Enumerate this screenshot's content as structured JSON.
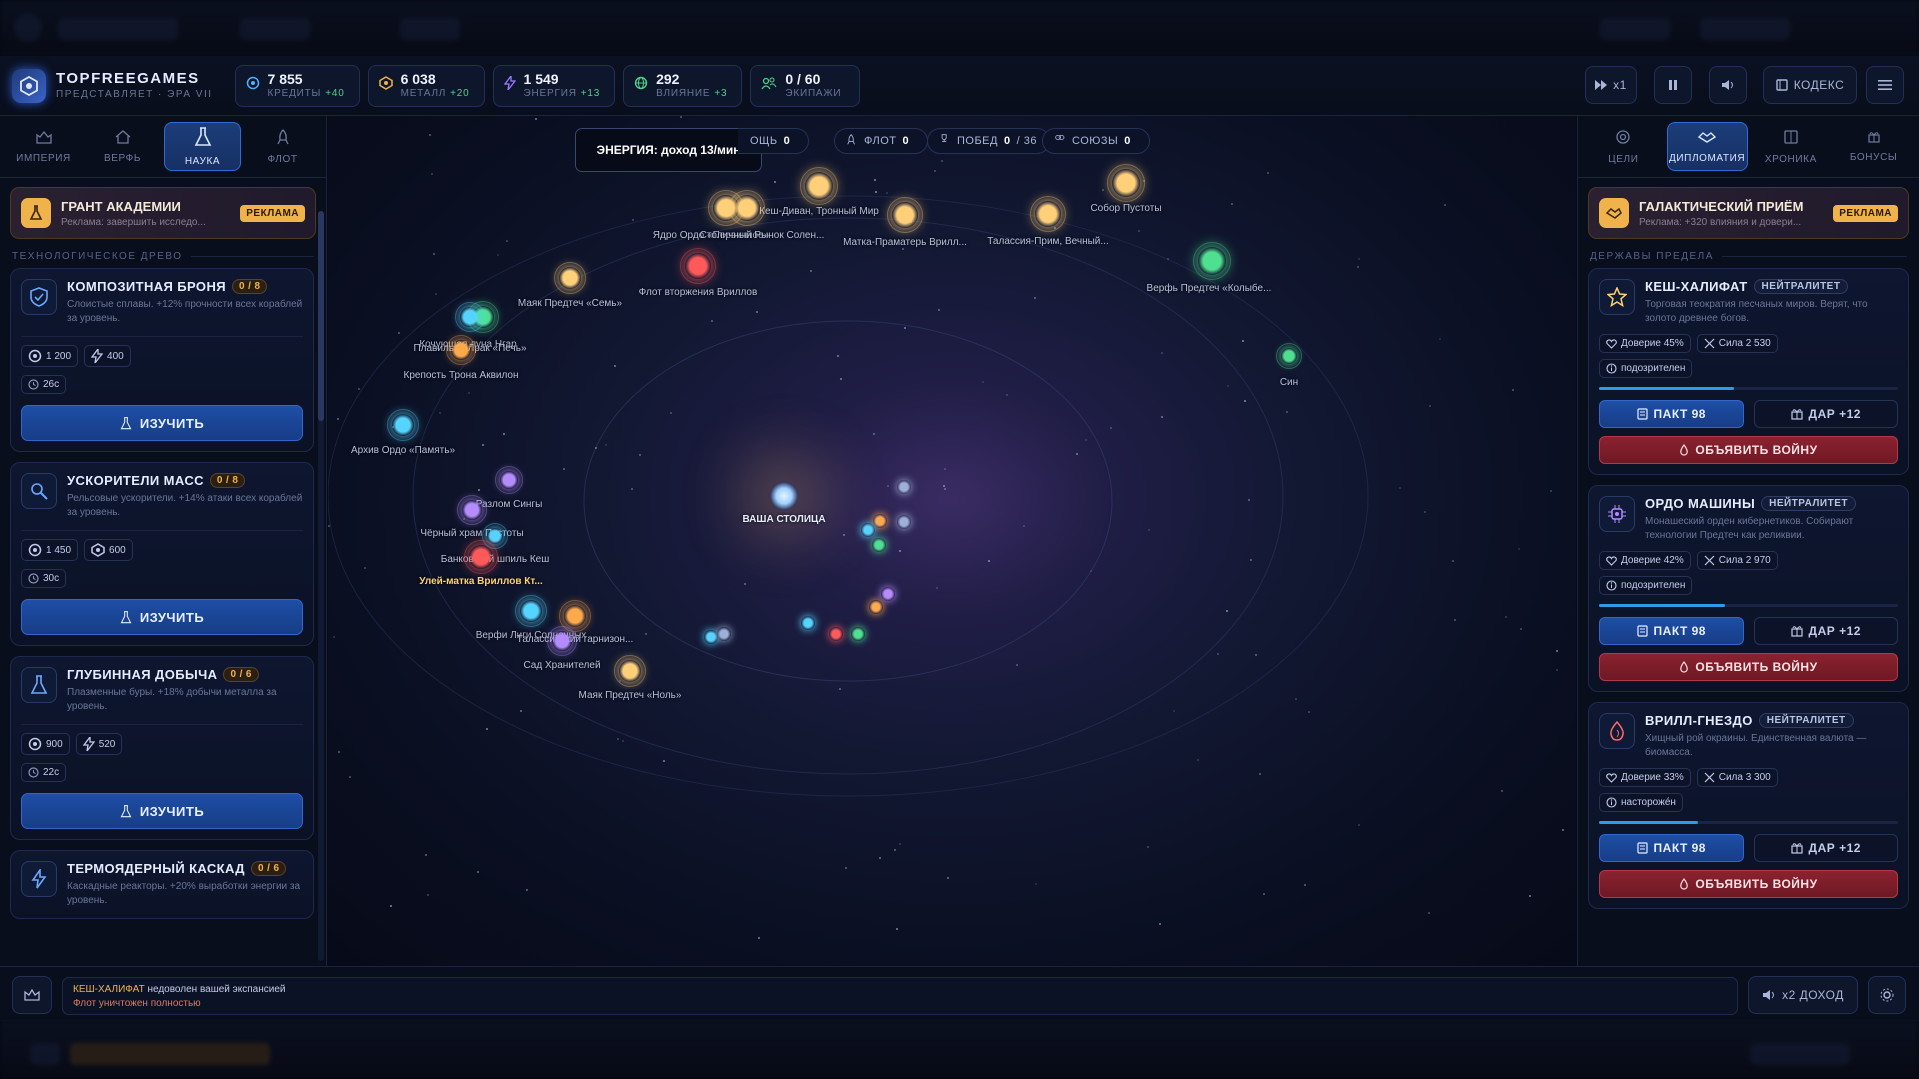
{
  "brand": {
    "title": "TOPFREEGAMES",
    "subtitle": "ПРЕДСТАВЛЯЕТ · ЭРА VII"
  },
  "resources": [
    {
      "value": "7 855",
      "label": "КРЕДИТЫ",
      "delta": "+40",
      "icon": "credit-icon",
      "color": "#4fb4ff"
    },
    {
      "value": "6 038",
      "label": "МЕТАЛЛ",
      "delta": "+20",
      "icon": "metal-icon",
      "color": "#f0b24b"
    },
    {
      "value": "1 549",
      "label": "ЭНЕРГИЯ",
      "delta": "+13",
      "icon": "energy-icon",
      "color": "#9b7bff"
    },
    {
      "value": "292",
      "label": "ВЛИЯНИЕ",
      "delta": "+3",
      "icon": "globe-icon",
      "color": "#4fd18b"
    },
    {
      "value": "0 / 60",
      "label": "ЭКИПАЖИ",
      "delta": "",
      "icon": "crew-icon",
      "color": "#4fd18b"
    }
  ],
  "topright": {
    "speed": "x1",
    "codex": "КОДЕКС"
  },
  "left_tabs": [
    "ИМПЕРИЯ",
    "ВЕРФЬ",
    "НАУКА",
    "ФЛОТ"
  ],
  "left_ad": {
    "title": "ГРАНТ АКАДЕМИИ",
    "desc": "Реклама: завершить исследо...",
    "badge": "РЕКЛАМА"
  },
  "tech_section": "ТЕХНОЛОГИЧЕСКОЕ ДРЕВО",
  "techs": [
    {
      "name": "КОМПОЗИТНАЯ БРОНЯ",
      "level": "0 / 8",
      "desc": "Слоистые сплавы. +12% прочности всех кораблей за уровень.",
      "cost1": "1 200",
      "cost2": "400",
      "cost2_icon": "energy-icon",
      "time": "26с",
      "btn": "ИЗУЧИТЬ"
    },
    {
      "name": "УСКОРИТЕЛИ МАСС",
      "level": "0 / 8",
      "desc": "Рельсовые ускорители. +14% атаки всех кораблей за уровень.",
      "cost1": "1 450",
      "cost2": "600",
      "cost2_icon": "metal-icon",
      "time": "30с",
      "btn": "ИЗУЧИТЬ"
    },
    {
      "name": "ГЛУБИННАЯ ДОБЫЧА",
      "level": "0 / 6",
      "desc": "Плазменные буры. +18% добычи металла за уровень.",
      "cost1": "900",
      "cost2": "520",
      "cost2_icon": "energy-icon",
      "time": "22с",
      "btn": "ИЗУЧИТЬ"
    },
    {
      "name": "ТЕРМОЯДЕРНЫЙ КАСКАД",
      "level": "0 / 6",
      "desc": "Каскадные реакторы. +20% выработки энергии за уровень.",
      "cost1": "",
      "cost2": "",
      "cost2_icon": "",
      "time": "",
      "btn": ""
    }
  ],
  "map_pills": [
    {
      "label": "ОЩЬ",
      "value": "0",
      "extra": ""
    },
    {
      "label": "ФЛОТ",
      "value": "0",
      "extra": ""
    },
    {
      "label": "ПОБЕД",
      "value": "0",
      "extra": "/ 36"
    },
    {
      "label": "СОЮЗЫ",
      "value": "0",
      "extra": ""
    }
  ],
  "tooltip": "ЭНЕРГИЯ: доход 13/мин",
  "capital": "ВАША СТОЛИЦА",
  "systems": [
    {
      "label": "Собор Пустоты",
      "color": "#ffcf7a"
    },
    {
      "label": "Кеш-Диван, Тронный Мир",
      "color": "#ffcf7a"
    },
    {
      "label": "Ядро Ордо «Первичное»",
      "color": "#ffcf7a"
    },
    {
      "label": "Столичный Рынок Солен...",
      "color": "#ffcf7a"
    },
    {
      "label": "Матка-Праматерь Врилл...",
      "color": "#ffcf7a"
    },
    {
      "label": "Талассия-Прим, Вечный...",
      "color": "#ffcf7a"
    },
    {
      "label": "Верфь Предтеч «Колыбе...",
      "color": "#4fe08f"
    },
    {
      "label": "Флот вторжения Вриллов",
      "color": "#ff5a5a"
    },
    {
      "label": "Маяк Предтеч «Семь»",
      "color": "#ffcf7a"
    },
    {
      "label": "Кочующая луна Нгар",
      "color": "#4fe08f"
    },
    {
      "label": "Плавильня Лрак «Печь»",
      "color": "#55d4ff"
    },
    {
      "label": "Крепость Трона Аквилон",
      "color": "#ffa94d"
    },
    {
      "label": "Архив Ордо «Память»",
      "color": "#55d4ff"
    },
    {
      "label": "Разлом Сингы",
      "color": "#b48cff"
    },
    {
      "label": "Чёрный храм Пустоты",
      "color": "#b48cff"
    },
    {
      "label": "Банковский шпиль Кеш",
      "color": "#55d4ff"
    },
    {
      "label": "Улей-матка Вриллов Кт...",
      "color": "#ff5a5a"
    },
    {
      "label": "Верфи Лиги Солнечных",
      "color": "#55d4ff"
    },
    {
      "label": "Талассийский гарнизон...",
      "color": "#ffa94d"
    },
    {
      "label": "Сад Хранителей",
      "color": "#b48cff"
    },
    {
      "label": "Маяк Предтеч «Ноль»",
      "color": "#ffcf7a"
    },
    {
      "label": "Син",
      "color": "#4fe08f"
    }
  ],
  "right_tabs": [
    "ЦЕЛИ",
    "ДИПЛОМАТИЯ",
    "ХРОНИКА",
    "БОНУСЫ"
  ],
  "right_ad": {
    "title": "ГАЛАКТИЧЕСКИЙ ПРИЁМ",
    "desc": "Реклама: +320 влияния и довери...",
    "badge": "РЕКЛАМА"
  },
  "powers_section": "ДЕРЖАВЫ ПРЕДЕЛА",
  "powers": [
    {
      "name": "КЕШ-ХАЛИФАТ",
      "status": "НЕЙТРАЛИТЕТ",
      "desc": "Торговая теократия песчаных миров. Верят, что золото древнее богов.",
      "trust": "Доверие 45%",
      "power": "Сила 2 530",
      "mood": "подозрителен",
      "trust_level": 0.45,
      "icon": "star-icon",
      "pact": "ПАКТ 98",
      "gift": "ДАР +12",
      "war": "ОБЪЯВИТЬ ВОЙНУ"
    },
    {
      "name": "ОРДО МАШИНЫ",
      "status": "НЕЙТРАЛИТЕТ",
      "desc": "Монашеский орден кибернетиков. Собирают технологии Предтеч как реликвии.",
      "trust": "Доверие 42%",
      "power": "Сила 2 970",
      "mood": "подозрителен",
      "trust_level": 0.42,
      "icon": "chip-icon",
      "pact": "ПАКТ 98",
      "gift": "ДАР +12",
      "war": "ОБЪЯВИТЬ ВОЙНУ"
    },
    {
      "name": "ВРИЛЛ-ГНЕЗДО",
      "status": "НЕЙТРАЛИТЕТ",
      "desc": "Хищный рой окраины. Единственная валюта — биомасса.",
      "trust": "Доверие 33%",
      "power": "Сила 3 300",
      "mood": "настороже́н",
      "trust_level": 0.33,
      "icon": "drop-icon",
      "pact": "ПАКТ 98",
      "gift": "ДАР +12",
      "war": "ОБЪЯВИТЬ ВОЙНУ"
    }
  ],
  "log": {
    "line1_name": "КЕШ-ХАЛИФАТ",
    "line1_text": " недоволен вашей экспансией",
    "line2": "Флот уничтожен полностью"
  },
  "bottom_right": {
    "double": "x2 ДОХОД"
  }
}
